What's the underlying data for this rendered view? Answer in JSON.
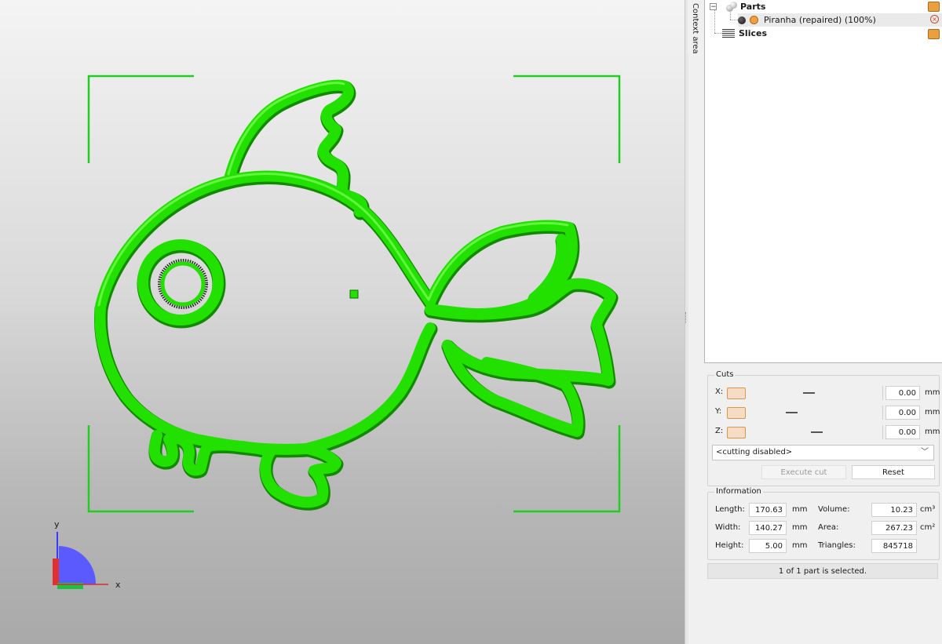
{
  "viewport": {
    "model_color": "#22dd00",
    "frame_color": "#22cc22",
    "axes": {
      "y_label": "y",
      "x_label": "x"
    }
  },
  "side": {
    "context_area_label": "Context area"
  },
  "tree": {
    "parts_label": "Parts",
    "part_item_label": "Piranha (repaired) (100%)",
    "slices_label": "Slices",
    "expander_symbol": "−"
  },
  "cuts": {
    "title": "Cuts",
    "rows": [
      {
        "axis": "X:",
        "value": "0.00",
        "unit": "mm"
      },
      {
        "axis": "Y:",
        "value": "0.00",
        "unit": "mm"
      },
      {
        "axis": "Z:",
        "value": "0.00",
        "unit": "mm"
      }
    ],
    "mode_select": "<cutting disabled>",
    "execute_label": "Execute cut",
    "reset_label": "Reset"
  },
  "information": {
    "title": "Information",
    "length_label": "Length:",
    "length_value": "170.63",
    "length_unit": "mm",
    "width_label": "Width:",
    "width_value": "140.27",
    "width_unit": "mm",
    "height_label": "Height:",
    "height_value": "5.00",
    "height_unit": "mm",
    "volume_label": "Volume:",
    "volume_value": "10.23",
    "volume_unit": "cm³",
    "area_label": "Area:",
    "area_value": "267.23",
    "area_unit": "cm²",
    "triangles_label": "Triangles:",
    "triangles_value": "845718"
  },
  "status": {
    "selection_text": "1 of 1 part is selected."
  }
}
